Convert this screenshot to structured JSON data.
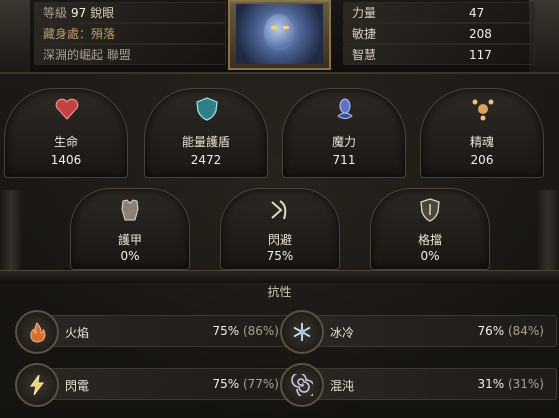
{
  "header": {
    "level_label": "等級",
    "level": "97",
    "class_name": "銳眼",
    "hideout_label": "藏身處：",
    "hideout": "殞落",
    "guild": "深淵的崛起 聯盟",
    "attributes": [
      {
        "label": "力量",
        "value": "47"
      },
      {
        "label": "敏捷",
        "value": "208"
      },
      {
        "label": "智慧",
        "value": "117"
      }
    ]
  },
  "core_stats": [
    {
      "name": "生命",
      "value": "1406",
      "icon": "heart-icon",
      "color": "#c94040"
    },
    {
      "name": "能量護盾",
      "value": "2472",
      "icon": "shield-icon",
      "color": "#5fc0c8"
    },
    {
      "name": "魔力",
      "value": "711",
      "icon": "mana-icon",
      "color": "#6f87d8"
    },
    {
      "name": "精魂",
      "value": "206",
      "icon": "spirit-icon",
      "color": "#d9a35a"
    }
  ],
  "defenses": [
    {
      "name": "護甲",
      "value": "0%",
      "icon": "armour-icon"
    },
    {
      "name": "閃避",
      "value": "75%",
      "icon": "evasion-icon"
    },
    {
      "name": "格擋",
      "value": "0%",
      "icon": "block-icon"
    }
  ],
  "resistances_title": "抗性",
  "resistances": [
    {
      "name": "火焰",
      "value": "75%",
      "max": "(86%)",
      "icon": "fire-icon",
      "color": "#d8702f"
    },
    {
      "name": "冰冷",
      "value": "76%",
      "max": "(84%)",
      "icon": "cold-icon",
      "color": "#9fc7e8"
    },
    {
      "name": "閃電",
      "value": "75%",
      "max": "(77%)",
      "icon": "lightning-icon",
      "color": "#e8d36a"
    },
    {
      "name": "混沌",
      "value": "31%",
      "max": "(31%)",
      "icon": "chaos-icon",
      "color": "#b79ad6"
    }
  ]
}
